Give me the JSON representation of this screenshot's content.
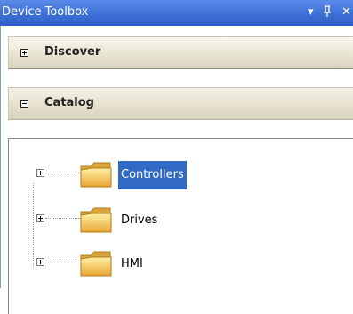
{
  "window": {
    "title": "Device Toolbox"
  },
  "titlebar_controls": {
    "dropdown": "▾",
    "pin": "ᚸ",
    "close": "✕"
  },
  "sections": [
    {
      "label": "Discover",
      "expanded": false,
      "toggle_icon": "plus-box-icon"
    },
    {
      "label": "Catalog",
      "expanded": true,
      "toggle_icon": "minus-box-icon"
    }
  ],
  "tree": {
    "items": [
      {
        "label": "Controllers",
        "selected": true,
        "icon": "folder-icon"
      },
      {
        "label": "Drives",
        "selected": false,
        "icon": "folder-icon"
      },
      {
        "label": "HMI",
        "selected": false,
        "icon": "folder-icon"
      }
    ]
  },
  "colors": {
    "titlebar": "#3d70d7",
    "selection": "#316ac5",
    "folder_fill": "#f6c84a"
  }
}
